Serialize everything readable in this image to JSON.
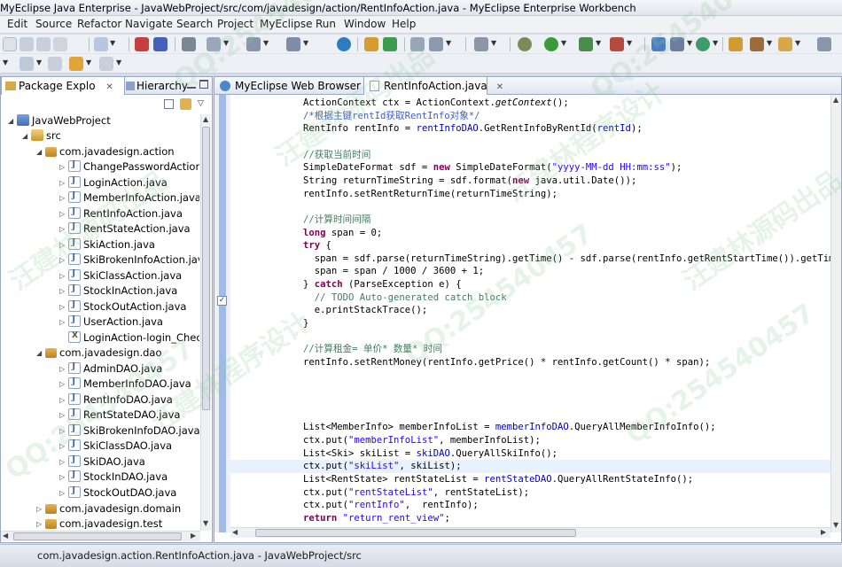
{
  "window": {
    "title": "MyEclipse Java Enterprise - JavaWebProject/src/com/javadesign/action/RentInfoAction.java - MyEclipse Enterprise Workbench"
  },
  "menu": [
    "Edit",
    "Source",
    "Refactor",
    "Navigate",
    "Search",
    "Project",
    "MyEclipse",
    "Run",
    "Window",
    "Help"
  ],
  "left_panel": {
    "tabs": [
      {
        "label": "Package Explo",
        "close": "✕"
      },
      {
        "label": "Hierarchy"
      }
    ],
    "tree": [
      {
        "label": "JavaWebProject",
        "icon": "project-icon"
      },
      {
        "label": "src",
        "icon": "source-folder-icon"
      },
      {
        "label": "com.javadesign.action",
        "icon": "package-icon"
      },
      {
        "label": "ChangePasswordAction.ja",
        "icon": "java-file-icon"
      },
      {
        "label": "LoginAction.java",
        "icon": "java-file-icon"
      },
      {
        "label": "MemberInfoAction.java",
        "icon": "java-file-icon"
      },
      {
        "label": "RentInfoAction.java",
        "icon": "java-file-icon"
      },
      {
        "label": "RentStateAction.java",
        "icon": "java-file-icon"
      },
      {
        "label": "SkiAction.java",
        "icon": "java-file-icon"
      },
      {
        "label": "SkiBrokenInfoAction.java",
        "icon": "java-file-icon"
      },
      {
        "label": "SkiClassAction.java",
        "icon": "java-file-icon"
      },
      {
        "label": "StockInAction.java",
        "icon": "java-file-icon"
      },
      {
        "label": "StockOutAction.java",
        "icon": "java-file-icon"
      },
      {
        "label": "UserAction.java",
        "icon": "java-file-icon"
      },
      {
        "label": "LoginAction-login_CheckL",
        "icon": "xml-file-icon"
      },
      {
        "label": "com.javadesign.dao",
        "icon": "package-icon"
      },
      {
        "label": "AdminDAO.java",
        "icon": "java-file-icon"
      },
      {
        "label": "MemberInfoDAO.java",
        "icon": "java-file-icon"
      },
      {
        "label": "RentInfoDAO.java",
        "icon": "java-file-icon"
      },
      {
        "label": "RentStateDAO.java",
        "icon": "java-file-icon"
      },
      {
        "label": "SkiBrokenInfoDAO.java",
        "icon": "java-file-icon"
      },
      {
        "label": "SkiClassDAO.java",
        "icon": "java-file-icon"
      },
      {
        "label": "SkiDAO.java",
        "icon": "java-file-icon"
      },
      {
        "label": "StockInDAO.java",
        "icon": "java-file-icon"
      },
      {
        "label": "StockOutDAO.java",
        "icon": "java-file-icon"
      },
      {
        "label": "com.javadesign.domain",
        "icon": "package-icon"
      },
      {
        "label": "com.javadesign.test",
        "icon": "package-icon"
      }
    ]
  },
  "editor": {
    "tabs": [
      {
        "label": "MyEclipse Web Browser"
      },
      {
        "label": "RentInfoAction.java",
        "close": "✕"
      }
    ],
    "lines": [
      [
        [
          "n",
          "ActionContext ctx = ActionContext."
        ],
        [
          "it",
          "getContext"
        ],
        [
          "n",
          "();"
        ]
      ],
      [
        [
          "jd",
          "/*根据主键rentId获取RentInfo对象*/"
        ]
      ],
      [
        [
          "n",
          "RentInfo rentInfo = "
        ],
        [
          "fd",
          "rentInfoDAO"
        ],
        [
          "n",
          ".GetRentInfoByRentId("
        ],
        [
          "fd",
          "rentId"
        ],
        [
          "n",
          ");"
        ]
      ],
      [],
      [
        [
          "cm",
          "//获取当前时间"
        ]
      ],
      [
        [
          "n",
          "SimpleDateFormat sdf = "
        ],
        [
          "kw",
          "new"
        ],
        [
          "n",
          " SimpleDateFormat("
        ],
        [
          "st",
          "\"yyyy-MM-dd HH:mm:ss\""
        ],
        [
          "n",
          ");"
        ]
      ],
      [
        [
          "n",
          "String returnTimeString = sdf.format("
        ],
        [
          "kw",
          "new"
        ],
        [
          "n",
          " java.util.Date());"
        ]
      ],
      [
        [
          "n",
          "rentInfo.setRentReturnTime(returnTimeString);"
        ]
      ],
      [],
      [
        [
          "cm",
          "//计算时间间隔"
        ]
      ],
      [
        [
          "kw",
          "long"
        ],
        [
          "n",
          " span = 0;"
        ]
      ],
      [
        [
          "kw",
          "try"
        ],
        [
          "n",
          " {"
        ]
      ],
      [
        [
          "n",
          "  span = sdf.parse(returnTimeString).getTime() - sdf.parse(rentInfo.getRentStartTime()).getTime();"
        ]
      ],
      [
        [
          "n",
          "  span = span / 1000 / 3600 + 1;"
        ]
      ],
      [
        [
          "n",
          "} "
        ],
        [
          "kw",
          "catch"
        ],
        [
          "n",
          " (ParseException e) {"
        ]
      ],
      [
        [
          "n",
          "  "
        ],
        [
          "cm",
          "// TODO Auto-generated catch block"
        ]
      ],
      [
        [
          "n",
          "  e.printStackTrace();"
        ]
      ],
      [
        [
          "n",
          "}"
        ]
      ],
      [],
      [
        [
          "cm",
          "//计算租金= 单价* 数量* 时间"
        ]
      ],
      [
        [
          "n",
          "rentInfo.setRentMoney(rentInfo.getPrice() * rentInfo.getCount() * span);"
        ]
      ],
      [],
      [],
      [],
      [],
      [
        [
          "n",
          "List<MemberInfo> memberInfoList = "
        ],
        [
          "fd",
          "memberInfoDAO"
        ],
        [
          "n",
          ".QueryAllMemberInfoInfo();"
        ]
      ],
      [
        [
          "n",
          "ctx.put("
        ],
        [
          "st",
          "\"memberInfoList\""
        ],
        [
          "n",
          ", memberInfoList);"
        ]
      ],
      [
        [
          "n",
          "List<Ski> skiList = "
        ],
        [
          "fd",
          "skiDAO"
        ],
        [
          "n",
          ".QueryAllSkiInfo();"
        ]
      ],
      [
        [
          "n",
          "ctx.put("
        ],
        [
          "st",
          "\"skiList\""
        ],
        [
          "n",
          ", skiList);"
        ]
      ],
      [
        [
          "n",
          "List<RentState> rentStateList = "
        ],
        [
          "fd",
          "rentStateDAO"
        ],
        [
          "n",
          ".QueryAllRentStateInfo();"
        ]
      ],
      [
        [
          "n",
          "ctx.put("
        ],
        [
          "st",
          "\"rentStateList\""
        ],
        [
          "n",
          ", rentStateList);"
        ]
      ],
      [
        [
          "n",
          "ctx.put("
        ],
        [
          "st",
          "\"rentInfo\""
        ],
        [
          "n",
          ",  rentInfo);"
        ]
      ],
      [
        [
          "kw",
          "return"
        ],
        [
          "n",
          " "
        ],
        [
          "st",
          "\"return_rent_view\""
        ],
        [
          "n",
          ";"
        ]
      ]
    ],
    "current_line": 28
  },
  "status_bar": {
    "text": "com.javadesign.action.RentInfoAction.java - JavaWebProject/src"
  },
  "watermarks": [
    "QQ:254540457",
    "汪建林源码出品",
    "汪建林程序设计",
    "QQ:254540457",
    "汪建林源码出品",
    "QQ:254540457",
    "汪建林程序设计",
    "QQ:254540457",
    "汪建林源码出品",
    "QQ:254540457"
  ]
}
